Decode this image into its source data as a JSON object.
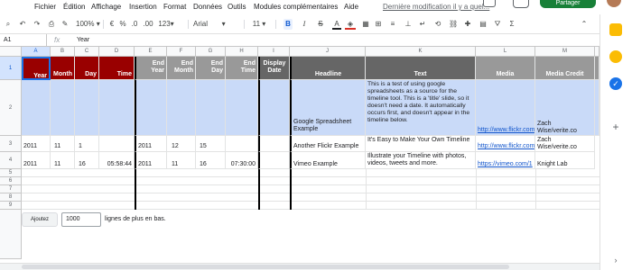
{
  "menu": {
    "items": [
      "Fichier",
      "Édition",
      "Affichage",
      "Insertion",
      "Format",
      "Données",
      "Outils",
      "Modules complémentaires",
      "Aide"
    ],
    "last_edit": "Dernière modification il y a quel..."
  },
  "share": {
    "label": "Partager"
  },
  "toolbar": {
    "zoom": "100%",
    "currency": "€",
    "percent": "%",
    "dec_less": ".0",
    "dec_more": ".00",
    "format": "123",
    "font": "Arial",
    "font_size": "11",
    "bold": "B",
    "italic": "I",
    "strike": "S",
    "text_color": "A"
  },
  "formula_bar": {
    "cell_ref": "A1",
    "fx": "fx",
    "value": "Year"
  },
  "columns": [
    "A",
    "B",
    "C",
    "D",
    "E",
    "F",
    "G",
    "H",
    "I",
    "J",
    "K",
    "L",
    "M"
  ],
  "rows": [
    "1",
    "2",
    "3",
    "4",
    "5",
    "6",
    "7",
    "8",
    "9"
  ],
  "header": {
    "year": "Year",
    "month": "Month",
    "day": "Day",
    "time": "Time",
    "end_year_1": "End",
    "end_year_2": "Year",
    "end_month_1": "End",
    "end_month_2": "Month",
    "end_day_1": "End",
    "end_day_2": "Day",
    "end_time_1": "End",
    "end_time_2": "Time",
    "display_1": "Display",
    "display_2": "Date",
    "headline": "Headline",
    "text": "Text",
    "media": "Media",
    "media_credit": "Media Credit"
  },
  "row2": {
    "headline": "Google Spreadsheet Example",
    "text": "This is a test of using google spreadsheets as a source for the timeline tool. This is a 'title' slide, so it doesn't need a date. It automatically occurs first, and doesn't appear in the timeline below.",
    "media": "http://www.flickr.com",
    "credit_1": "Zach",
    "credit_2": "Wise/verite.co"
  },
  "row3": {
    "year": "2011",
    "month": "11",
    "day": "1",
    "end_year": "2011",
    "end_month": "12",
    "end_day": "15",
    "headline": "Another Flickr Example",
    "text": "It's Easy to Make Your Own Timeline",
    "media": "http://www.flickr.com",
    "credit_1": "Zach",
    "credit_2": "Wise/verite.co"
  },
  "row4": {
    "year": "2011",
    "month": "11",
    "day": "16",
    "time": "05:58:44",
    "end_year": "2011",
    "end_month": "11",
    "end_day": "16",
    "end_time": "07:30:00",
    "headline": "Vimeo Example",
    "text": "Illustrate your Timeline with photos, videos, tweets and more.",
    "media": "https://vimeo.com/1",
    "credit": "Knight Lab"
  },
  "add_rows": {
    "button": "Ajoutez",
    "count": "1000",
    "suffix": "lignes de plus en bas."
  },
  "colors": {
    "header_red": "#990000",
    "header_gray": "#999999",
    "header_dark": "#666666",
    "row_blue": "#c9daf8",
    "share_green": "#188038"
  }
}
